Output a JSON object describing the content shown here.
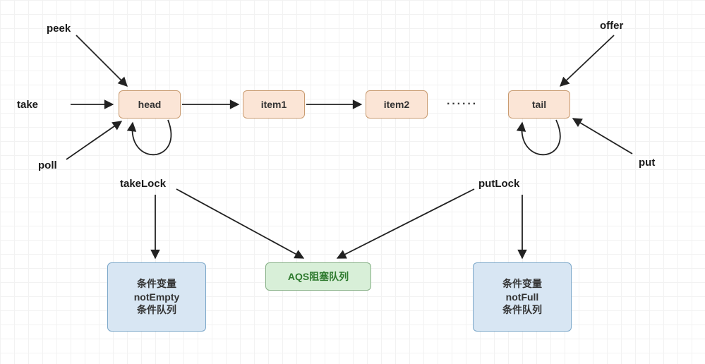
{
  "labels": {
    "peek": "peek",
    "take": "take",
    "poll": "poll",
    "offer": "offer",
    "put": "put",
    "takeLock": "takeLock",
    "putLock": "putLock",
    "dots": "······"
  },
  "nodes": {
    "head": "head",
    "item1": "item1",
    "item2": "item2",
    "tail": "tail",
    "notEmpty": "条件变量\nnotEmpty\n条件队列",
    "aqs": "AQS阻塞队列",
    "notFull": "条件变量\nnotFull\n条件队列"
  },
  "chart_data": {
    "type": "diagram",
    "title": "LinkedBlockingQueue structure",
    "queue_nodes": [
      {
        "id": "head",
        "label": "head",
        "kind": "queue-node"
      },
      {
        "id": "item1",
        "label": "item1",
        "kind": "queue-node"
      },
      {
        "id": "item2",
        "label": "item2",
        "kind": "queue-node"
      },
      {
        "id": "dots",
        "label": "······",
        "kind": "ellipsis"
      },
      {
        "id": "tail",
        "label": "tail",
        "kind": "queue-node"
      }
    ],
    "lower_nodes": [
      {
        "id": "notEmpty",
        "label": "条件变量 notEmpty 条件队列",
        "kind": "condition"
      },
      {
        "id": "aqs",
        "label": "AQS阻塞队列",
        "kind": "aqs"
      },
      {
        "id": "notFull",
        "label": "条件变量 notFull 条件队列",
        "kind": "condition"
      }
    ],
    "operations": {
      "head_side": [
        "peek",
        "take",
        "poll"
      ],
      "tail_side": [
        "offer",
        "put"
      ]
    },
    "locks": {
      "takeLock": {
        "guards": "head",
        "condition": "notEmpty",
        "aqs": "aqs"
      },
      "putLock": {
        "guards": "tail",
        "condition": "notFull",
        "aqs": "aqs"
      }
    },
    "edges": [
      {
        "from": "peek",
        "to": "head"
      },
      {
        "from": "take",
        "to": "head"
      },
      {
        "from": "poll",
        "to": "head"
      },
      {
        "from": "offer",
        "to": "tail"
      },
      {
        "from": "put",
        "to": "tail"
      },
      {
        "from": "head",
        "to": "item1"
      },
      {
        "from": "item1",
        "to": "item2"
      },
      {
        "from": "takeLock",
        "to": "head",
        "type": "self-loop"
      },
      {
        "from": "putLock",
        "to": "tail",
        "type": "self-loop"
      },
      {
        "from": "takeLock",
        "to": "notEmpty"
      },
      {
        "from": "takeLock",
        "to": "aqs"
      },
      {
        "from": "putLock",
        "to": "notFull"
      },
      {
        "from": "putLock",
        "to": "aqs"
      }
    ]
  }
}
